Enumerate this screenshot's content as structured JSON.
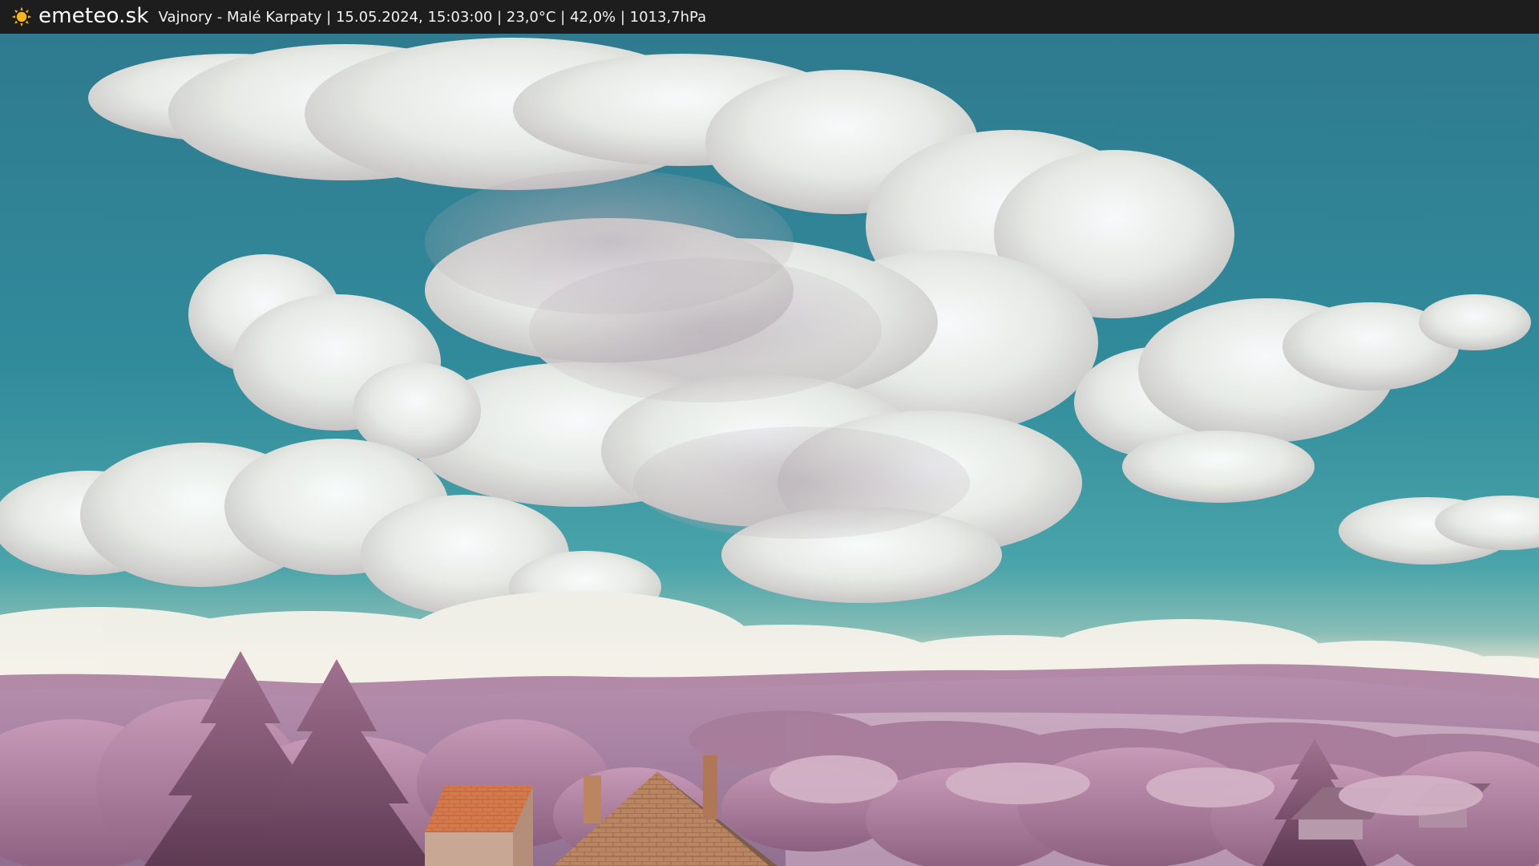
{
  "site": {
    "name": "emeteo.sk",
    "icon": "sun-icon"
  },
  "webcam": {
    "caption": "Vajnory - Malé Karpaty | 15.05.2024, 15:03:00 | 23,0°C | 42,0% | 1013,7hPa"
  },
  "colors": {
    "topbar_bg": "#1d1d1d",
    "sun_yellow": "#f5b51b",
    "sky_blue": "#2f8c9c",
    "foliage_pink": "#c58db0",
    "roof_orange": "#d67a4b"
  }
}
